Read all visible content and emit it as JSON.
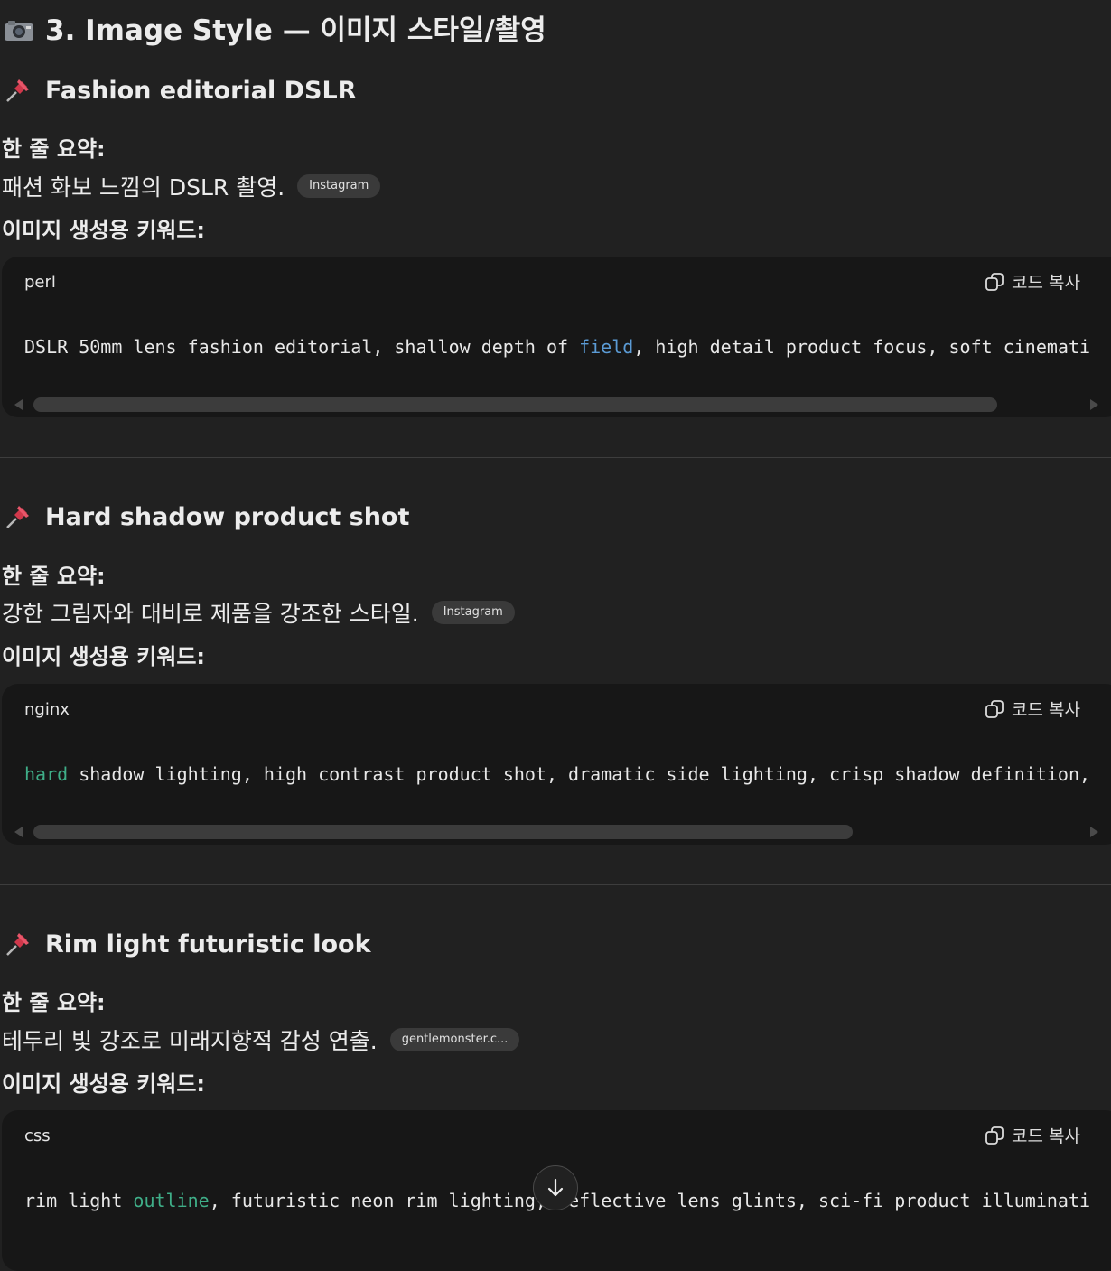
{
  "heading": {
    "text": "3. Image Style — 이미지 스타일/촬영",
    "icon": "camera-icon"
  },
  "sections": [
    {
      "title": "Fashion editorial DSLR",
      "summary_label": "한 줄 요약:",
      "summary": "패션 화보 느낌의 DSLR 촬영.",
      "source": "Instagram",
      "keywords_label": "이미지 생성용 키워드:",
      "code": {
        "language": "perl",
        "copy_label": "코드 복사",
        "parts": [
          "DSLR 50mm lens fashion editorial, shallow depth of ",
          "field",
          ", high detail product focus, soft cinemati"
        ]
      }
    },
    {
      "title": "Hard shadow product shot",
      "summary_label": "한 줄 요약:",
      "summary": "강한 그림자와 대비로 제품을 강조한 스타일.",
      "source": "Instagram",
      "keywords_label": "이미지 생성용 키워드:",
      "code": {
        "language": "nginx",
        "copy_label": "코드 복사",
        "parts": [
          "hard",
          " shadow lighting, high contrast product shot, dramatic side lighting, crisp shadow definition,"
        ]
      }
    },
    {
      "title": "Rim light futuristic look",
      "summary_label": "한 줄 요약:",
      "summary": "테두리 빛 강조로 미래지향적 감성 연출.",
      "source": "gentlemonster.c...",
      "keywords_label": "이미지 생성용 키워드:",
      "code": {
        "language": "css",
        "copy_label": "코드 복사",
        "parts": [
          "rim light ",
          "outline",
          ", futuristic neon rim lighting, reflective lens glints, sci-fi product illuminati"
        ]
      }
    }
  ],
  "colors": {
    "background": "#212121",
    "code_bg": "#171717",
    "keyword_blue": "#5b9bd5",
    "keyword_green": "#3fae88",
    "pin_red": "#d0384b"
  },
  "scroll_button": {
    "icon": "arrow-down-icon"
  }
}
